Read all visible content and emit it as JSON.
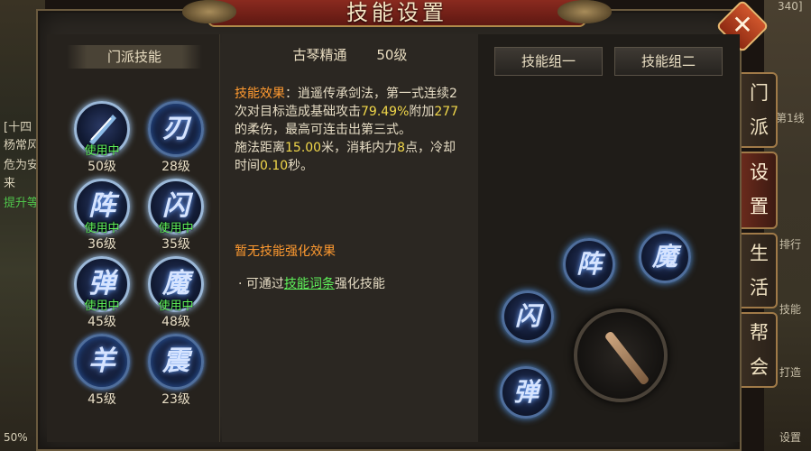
{
  "title": "技能设置",
  "close_label": "✕",
  "background": {
    "top_right_fragment": "340]",
    "left_lines": [
      "[十四",
      "杨常风",
      "危为安",
      "来"
    ],
    "left_green": "提升等",
    "right_labels": [
      "第1线",
      "排行",
      "技能",
      "打造",
      "设置"
    ],
    "bottom_left": "50%"
  },
  "left_panel": {
    "header": "门派技能",
    "skills": [
      {
        "glyph": "",
        "icon": "sword-slash-icon",
        "badge": "使用中",
        "level": "50级",
        "active": true
      },
      {
        "glyph": "刃",
        "icon": "blade-icon",
        "badge": "",
        "level": "28级",
        "active": false
      },
      {
        "glyph": "阵",
        "icon": "formation-icon",
        "badge": "使用中",
        "level": "36级",
        "active": true
      },
      {
        "glyph": "闪",
        "icon": "flash-icon",
        "badge": "使用中",
        "level": "35级",
        "active": true
      },
      {
        "glyph": "弹",
        "icon": "bounce-icon",
        "badge": "使用中",
        "level": "45级",
        "active": true
      },
      {
        "glyph": "魔",
        "icon": "magic-icon",
        "badge": "使用中",
        "level": "48级",
        "active": true
      },
      {
        "glyph": "羊",
        "icon": "ram-icon",
        "badge": "",
        "level": "45级",
        "active": false
      },
      {
        "glyph": "震",
        "icon": "quake-icon",
        "badge": "",
        "level": "23级",
        "active": false
      }
    ]
  },
  "detail": {
    "skill_name": "古琴精通",
    "skill_level": "50级",
    "effect_label": "技能效果",
    "effect_text_1": "：逍遥传承剑法，第一式连续2次对目标造成基础攻击",
    "effect_pct": "79.49%",
    "effect_text_2": "附加",
    "effect_dmg": "277",
    "effect_text_3": "的柔伤，最高可连击出第三式。",
    "range_label": "施法距离",
    "range_value": "15.00",
    "range_unit": "米，消耗内力",
    "mp_value": "8",
    "mp_unit": "点，冷却时间",
    "cd_value": "0.10",
    "cd_unit": "秒。",
    "no_enhance": "暂无技能强化效果",
    "hint_prefix": "· 可通过",
    "hint_link": "技能词条",
    "hint_suffix": "强化技能"
  },
  "right_panel": {
    "group_1": "技能组一",
    "group_2": "技能组二",
    "ring": [
      {
        "glyph": "阵",
        "icon": "formation-icon"
      },
      {
        "glyph": "魔",
        "icon": "magic-icon"
      },
      {
        "glyph": "闪",
        "icon": "flash-icon"
      },
      {
        "glyph": "弹",
        "icon": "bounce-icon"
      }
    ],
    "weapon_icon": "guqin-weapon-icon"
  },
  "side_tabs": [
    {
      "label": "门派",
      "active": false
    },
    {
      "label": "设置",
      "active": true
    },
    {
      "label": "生活",
      "active": false
    },
    {
      "label": "帮会",
      "active": false
    }
  ]
}
